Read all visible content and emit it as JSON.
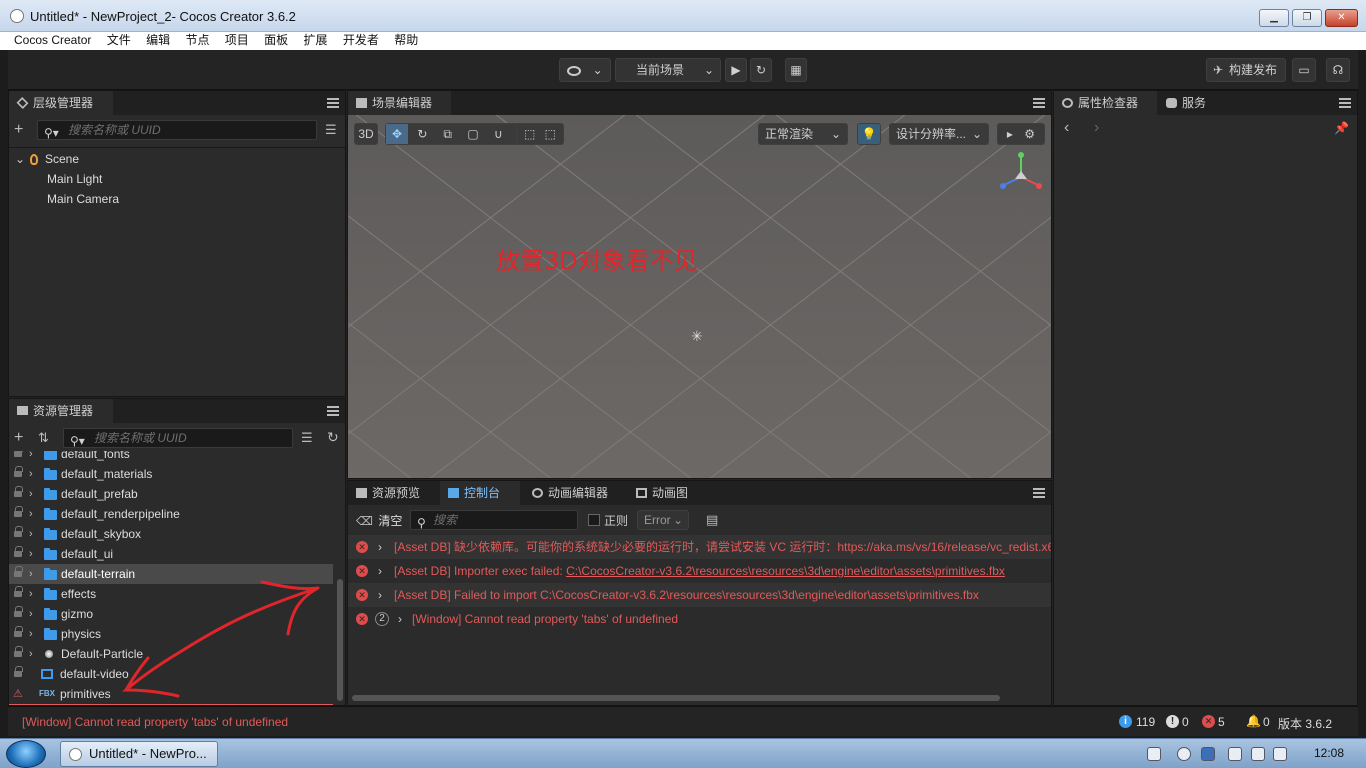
{
  "window": {
    "title": "Untitled* - NewProject_2- Cocos Creator 3.6.2"
  },
  "menu": [
    "Cocos Creator",
    "文件",
    "编辑",
    "节点",
    "项目",
    "面板",
    "扩展",
    "开发者",
    "帮助"
  ],
  "toolbar": {
    "scene_select": "当前场景",
    "build_label": "构建发布"
  },
  "hierarchy": {
    "title": "层级管理器",
    "search_placeholder": "搜索名称或 UUID",
    "nodes": [
      {
        "label": "Scene",
        "depth": 0
      },
      {
        "label": "Main Light",
        "depth": 1
      },
      {
        "label": "Main Camera",
        "depth": 1
      }
    ]
  },
  "assets": {
    "title": "资源管理器",
    "search_placeholder": "搜索名称或 UUID",
    "partial_top": "default_fonts",
    "items": [
      {
        "label": "default_materials",
        "kind": "folder",
        "selected": false
      },
      {
        "label": "default_prefab",
        "kind": "folder",
        "selected": false
      },
      {
        "label": "default_renderpipeline",
        "kind": "folder",
        "selected": false
      },
      {
        "label": "default_skybox",
        "kind": "folder",
        "selected": false
      },
      {
        "label": "default_ui",
        "kind": "folder",
        "selected": false
      },
      {
        "label": "default-terrain",
        "kind": "folder",
        "selected": true
      },
      {
        "label": "effects",
        "kind": "folder",
        "selected": false
      },
      {
        "label": "gizmo",
        "kind": "folder",
        "selected": false
      },
      {
        "label": "physics",
        "kind": "folder",
        "selected": false
      },
      {
        "label": "Default-Particle",
        "kind": "particle",
        "selected": false
      },
      {
        "label": "default-video",
        "kind": "video",
        "selected": false
      },
      {
        "label": "primitives",
        "kind": "fbx",
        "badge": "FBX",
        "selected": false
      }
    ]
  },
  "scene": {
    "title": "场景编辑器",
    "btn_3d": "3D",
    "render_mode": "正常渲染",
    "resolution": "设计分辨率...",
    "annotation": "放置3D对象看不见",
    "annotation_color": "#e0262b"
  },
  "inspector": {
    "tab_properties": "属性检查器",
    "tab_services": "服务"
  },
  "console": {
    "tabs": [
      "资源预览",
      "控制台",
      "动画编辑器",
      "动画图"
    ],
    "clear_label": "清空",
    "search_placeholder": "搜索",
    "regex_label": "正则",
    "level_select": "Error",
    "rows": [
      {
        "text": "[Asset DB] 缺少依赖库。可能你的系统缺少必要的运行时，请尝试安装 VC 运行时：https://aka.ms/vs/16/release/vc_redist.x6",
        "pre": "",
        "link": "",
        "post": "",
        "count": ""
      },
      {
        "text": "",
        "pre": "[Asset DB] Importer exec failed: ",
        "link": "C:\\CocosCreator-v3.6.2\\resources\\resources\\3d\\engine\\editor\\assets\\primitives.fbx",
        "post": "",
        "count": ""
      },
      {
        "text": "[Asset DB] Failed to import C:\\CocosCreator-v3.6.2\\resources\\resources\\3d\\engine\\editor\\assets\\primitives.fbx",
        "pre": "",
        "link": "",
        "post": "",
        "count": ""
      },
      {
        "text": "[Window] Cannot read property 'tabs' of undefined",
        "pre": "",
        "link": "",
        "post": "",
        "count": "2"
      }
    ],
    "error_color": "#e25a5a"
  },
  "status": {
    "message": "[Window] Cannot read property 'tabs' of undefined",
    "info_count": "119",
    "warn_count": "0",
    "error_count": "5",
    "notify_count": "0",
    "version": "版本 3.6.2"
  },
  "taskbar": {
    "item_label": "Untitled* - NewPro...",
    "clock": "12:08"
  }
}
